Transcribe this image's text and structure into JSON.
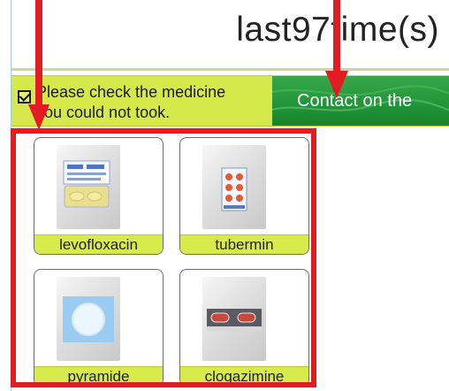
{
  "header": {
    "title": "last97time(s)"
  },
  "notice": {
    "line_1": "Please check the medicine",
    "line_2": "you could not took.",
    "checkbox_checked": true
  },
  "contact_button": {
    "label": "Contact on the"
  },
  "medicines": [
    {
      "label": "levofloxacin",
      "image_icon": "pill-sheet-icon"
    },
    {
      "label": "tubermin",
      "image_icon": "pill-blister-icon"
    },
    {
      "label": "pyramide",
      "image_icon": "white-pill-icon"
    },
    {
      "label": "clogazimine",
      "image_icon": "capsule-strip-icon"
    }
  ],
  "colors": {
    "header_rule": "#c8d8a0",
    "notice_bar": "#d6e84a",
    "contact_button": "#22963a",
    "card_label_bg": "#d9ea4c",
    "annotation_red": "#e21c22",
    "frame_blue": "#9fc7e6"
  },
  "annotations": {
    "arrows": [
      "arrow-down-icon",
      "arrow-down-icon",
      "arrow-down-icon"
    ],
    "highlight": "red-selection-box"
  }
}
